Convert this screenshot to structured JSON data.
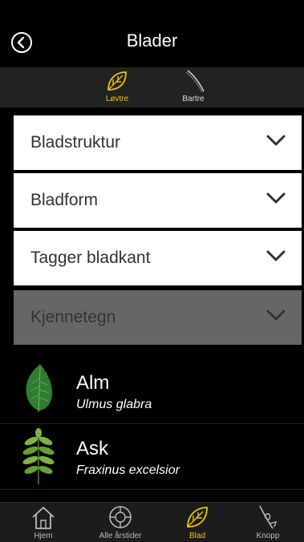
{
  "header": {
    "title": "Blader"
  },
  "tabs": [
    {
      "label": "Løvtre",
      "active": true
    },
    {
      "label": "Bartre",
      "active": false
    }
  ],
  "filters": [
    {
      "label": "Bladstruktur",
      "enabled": true
    },
    {
      "label": "Bladform",
      "enabled": true
    },
    {
      "label": "Tagger bladkant",
      "enabled": true
    },
    {
      "label": "Kjennetegn",
      "enabled": false
    }
  ],
  "species": [
    {
      "common": "Alm",
      "latin": "Ulmus glabra",
      "icon": "elm-leaf-icon"
    },
    {
      "common": "Ask",
      "latin": "Fraxinus excelsior",
      "icon": "ash-leaf-icon"
    }
  ],
  "tabbar": [
    {
      "label": "Hjem",
      "icon": "home-icon",
      "active": false
    },
    {
      "label": "Alle årstider",
      "icon": "seasons-icon",
      "active": false
    },
    {
      "label": "Blad",
      "icon": "leaf-icon",
      "active": true
    },
    {
      "label": "Knopp",
      "icon": "bud-icon",
      "active": false
    }
  ],
  "colors": {
    "accent": "#f2c200",
    "background": "#000000"
  }
}
